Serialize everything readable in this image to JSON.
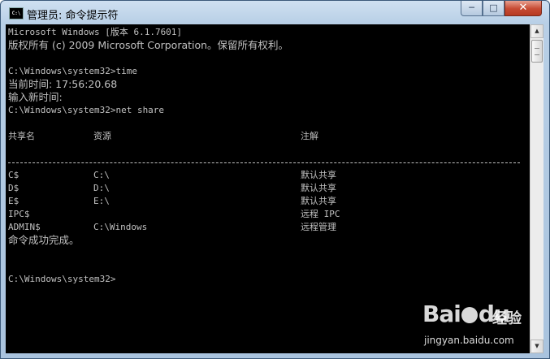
{
  "window": {
    "title": "管理员: 命令提示符",
    "icon_label": "C:\\",
    "controls": {
      "minimize": "─",
      "maximize": "□",
      "close": "✕"
    }
  },
  "console": {
    "lines": [
      "Microsoft Windows [版本 6.1.7601]",
      "版权所有 (c) 2009 Microsoft Corporation。保留所有权利。",
      "",
      "C:\\Windows\\system32>time",
      "当前时间: 17:56:20.68",
      "输入新时间:",
      "C:\\Windows\\system32>net share"
    ],
    "share_headers": {
      "name": "共享名",
      "resource": "资源",
      "remark": "注解"
    },
    "shares": [
      {
        "name": "C$",
        "resource": "C:\\",
        "remark": "默认共享"
      },
      {
        "name": "D$",
        "resource": "D:\\",
        "remark": "默认共享"
      },
      {
        "name": "E$",
        "resource": "E:\\",
        "remark": "默认共享"
      },
      {
        "name": "IPC$",
        "resource": "",
        "remark": "远程 IPC"
      },
      {
        "name": "ADMIN$",
        "resource": "C:\\Windows",
        "remark": "远程管理"
      }
    ],
    "completion": "命令成功完成。",
    "prompt": "C:\\Windows\\system32>"
  },
  "scrollbar": {
    "up_arrow": "▲",
    "down_arrow": "▼"
  },
  "watermark": {
    "logo_text": "Bai",
    "logo_suffix": "du",
    "brand_cn": "经验",
    "url": "jingyan.baidu.com"
  }
}
